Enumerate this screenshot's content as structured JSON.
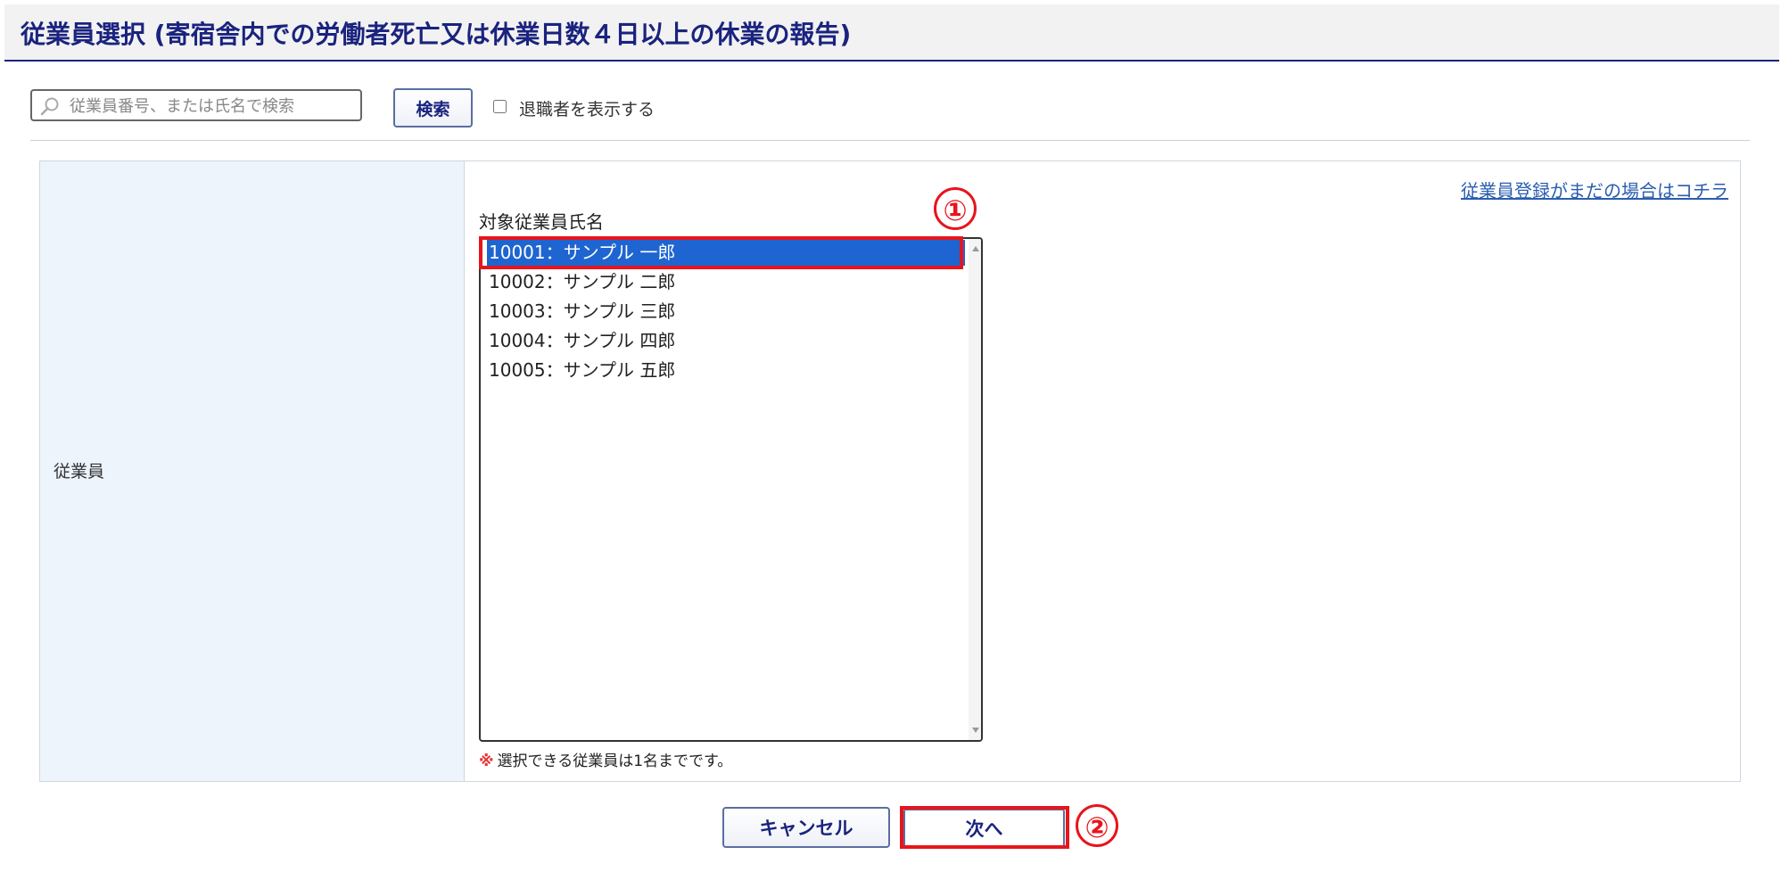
{
  "page": {
    "title": "従業員選択 (寄宿舎内での労働者死亡又は休業日数４日以上の休業の報告)"
  },
  "search": {
    "placeholder": "従業員番号、または氏名で検索",
    "value": "",
    "button_label": "検索",
    "show_retired_label": "退職者を表示する",
    "show_retired_checked": false
  },
  "form": {
    "employee_label": "従業員",
    "register_link": "従業員登録がまだの場合はコチラ",
    "list_caption": "対象従業員氏名",
    "employees": [
      {
        "label": "10001：サンプル 一郎",
        "selected": true
      },
      {
        "label": "10002：サンプル 二郎",
        "selected": false
      },
      {
        "label": "10003：サンプル 三郎",
        "selected": false
      },
      {
        "label": "10004：サンプル 四郎",
        "selected": false
      },
      {
        "label": "10005：サンプル 五郎",
        "selected": false
      }
    ],
    "note_mark": "※",
    "note_text": "選択できる従業員は1名までです。"
  },
  "footer": {
    "cancel_label": "キャンセル",
    "next_label": "次へ"
  },
  "annotations": {
    "marker_1": "①",
    "marker_2": "②"
  },
  "colors": {
    "accent": "#1a237e",
    "selection": "#1e65d1",
    "annotation_red": "#e8141c",
    "label_cell_bg": "#edf4fc",
    "link": "#2a5db0"
  },
  "icons": {
    "search": "search-icon"
  }
}
